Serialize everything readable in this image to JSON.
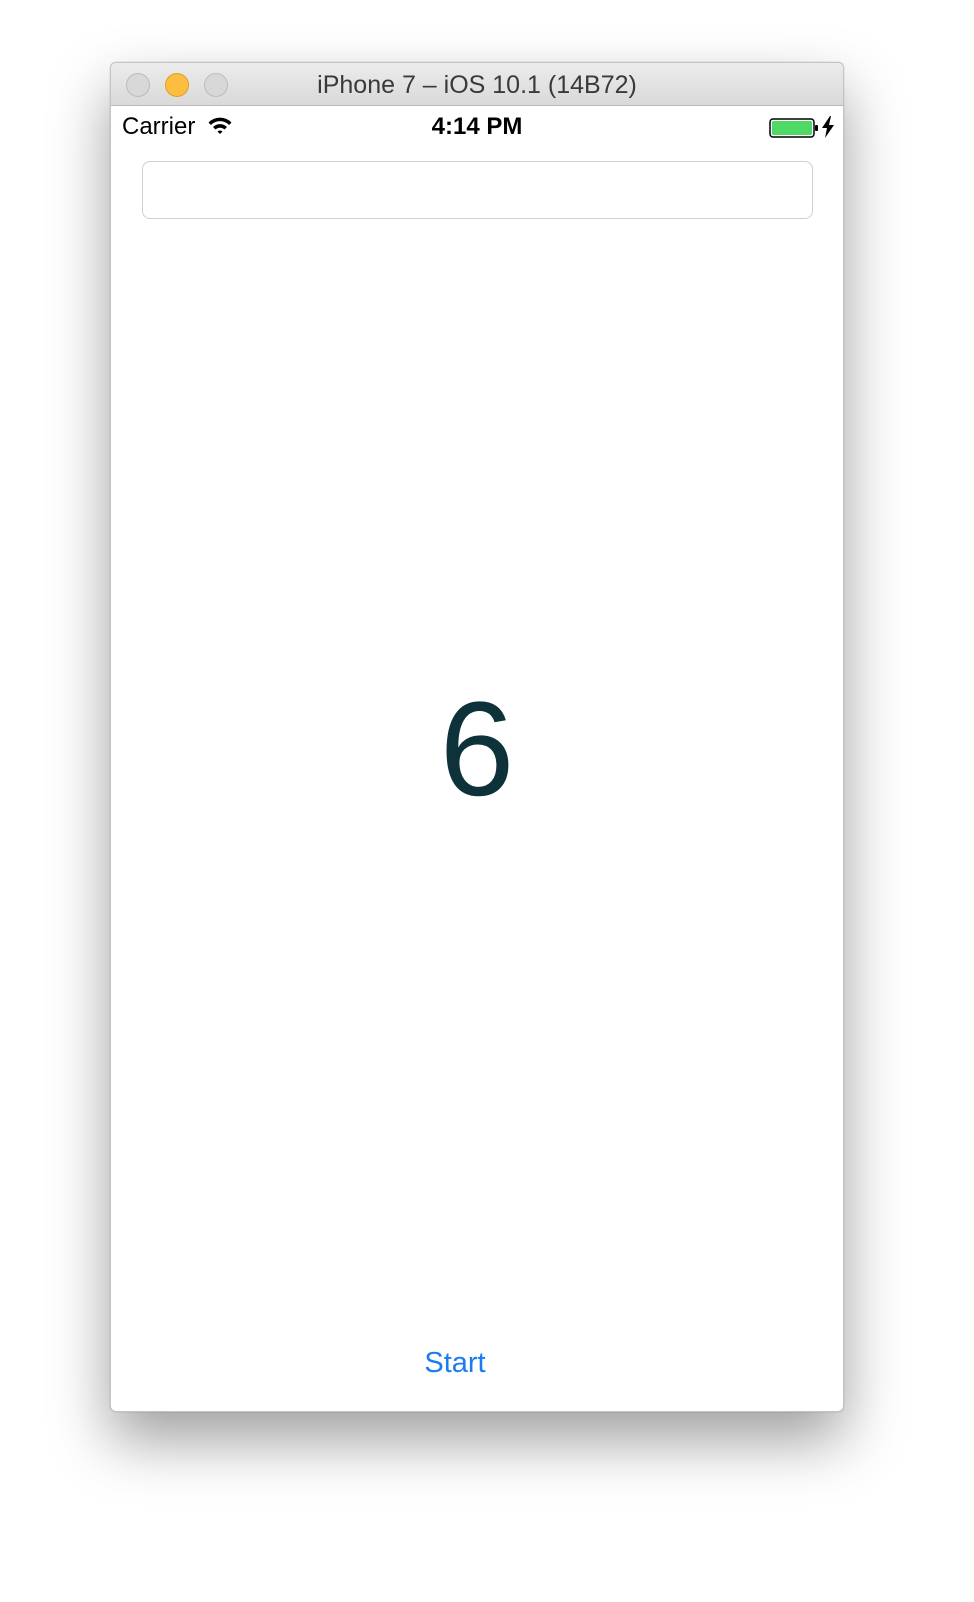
{
  "window": {
    "title": "iPhone 7 – iOS 10.1 (14B72)"
  },
  "statusbar": {
    "carrier": "Carrier",
    "time": "4:14 PM",
    "battery_level": 1.0,
    "charging": true
  },
  "main": {
    "text_field_value": "",
    "counter_value": "6",
    "start_label": "Start"
  },
  "colors": {
    "accent": "#1a7cf0",
    "counter_text": "#0d3239",
    "battery_fill": "#4cd964",
    "minimize": "#fdbd41"
  },
  "icons": {
    "wifi": "wifi-icon",
    "battery": "battery-icon",
    "charging": "lightning-bolt-icon"
  }
}
